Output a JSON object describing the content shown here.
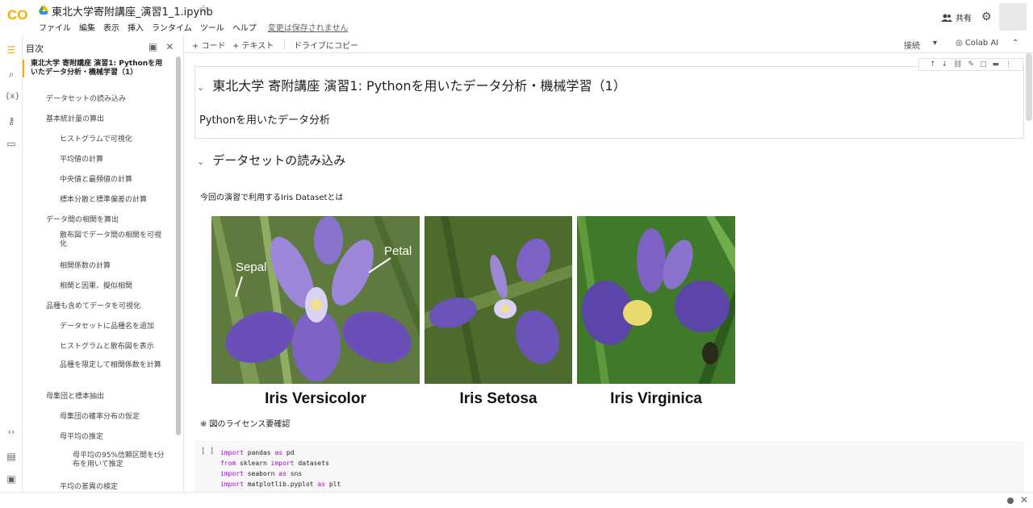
{
  "app": {
    "logo_text": "CO",
    "title": "東北大学寄附講座_演習1_1.ipynb",
    "star": "☆",
    "menu": [
      "ファイル",
      "編集",
      "表示",
      "挿入",
      "ランタイム",
      "ツール",
      "ヘルプ"
    ],
    "unsaved": "変更は保存されません",
    "share_label": "共有",
    "accent": "#f9ab00"
  },
  "toolbar": {
    "add_code": "+ コード",
    "add_text": "+ テキスト",
    "copy_drive": "ドライブにコピー",
    "connect": "接続",
    "connect_arrow": "▾",
    "colab_ai": "Colab AI",
    "collapse": "⌃"
  },
  "toc": {
    "title": "目次",
    "items": [
      {
        "label": "東北大学 寄附講座 演習1: Pythonを用いたデータ分析・機械学習（1）",
        "level": 0,
        "current": true
      },
      {
        "label": "データセットの読み込み",
        "level": 1
      },
      {
        "label": "基本統計量の算出",
        "level": 1
      },
      {
        "label": "ヒストグラムで可視化",
        "level": 2
      },
      {
        "label": "平均値の計算",
        "level": 2
      },
      {
        "label": "中央値と最頻値の計算",
        "level": 2
      },
      {
        "label": "標本分散と標準偏差の計算",
        "level": 2
      },
      {
        "label": "データ間の相関を算出",
        "level": 1
      },
      {
        "label": "散布図でデータ間の相関を可視化",
        "level": 2
      },
      {
        "label": "相関係数の計算",
        "level": 2
      },
      {
        "label": "相関と因果、擬似相関",
        "level": 2
      },
      {
        "label": "品種も含めてデータを可視化",
        "level": 1
      },
      {
        "label": "データセットに品種名を追加",
        "level": 2
      },
      {
        "label": "ヒストグラムと散布図を表示",
        "level": 2
      },
      {
        "label": "品種を限定して相関係数を計算",
        "level": 2
      },
      {
        "label": "母集団と標本抽出",
        "level": 1
      },
      {
        "label": "母集団の確率分布の仮定",
        "level": 2
      },
      {
        "label": "母平均の推定",
        "level": 2
      },
      {
        "label": "母平均の95%信頼区間をt分布を用いて推定",
        "level": 3
      },
      {
        "label": "平均の差異の検定",
        "level": 2
      }
    ]
  },
  "notebook": {
    "heading1": "東北大学 寄附講座 演習1: Pythonを用いたデータ分析・機械学習（1）",
    "subheading": "Pythonを用いたデータ分析",
    "heading2": "データセットの読み込み",
    "intro": "今回の演習で利用するIris Datasetとは",
    "image_labels": [
      "Iris Versicolor",
      "Iris Setosa",
      "Iris Virginica"
    ],
    "annotations": {
      "sepal": "Sepal",
      "petal": "Petal"
    },
    "license_note": "※ 図のライセンス要確認",
    "run_indicator": "[ ]",
    "code_lines": [
      [
        "import",
        " pandas ",
        "as",
        " pd"
      ],
      [
        "from",
        " sklearn ",
        "import",
        " datasets"
      ],
      [
        "import",
        " seaborn ",
        "as",
        " sns"
      ],
      [
        "import",
        " matplotlib.pyplot ",
        "as",
        " plt"
      ]
    ]
  }
}
